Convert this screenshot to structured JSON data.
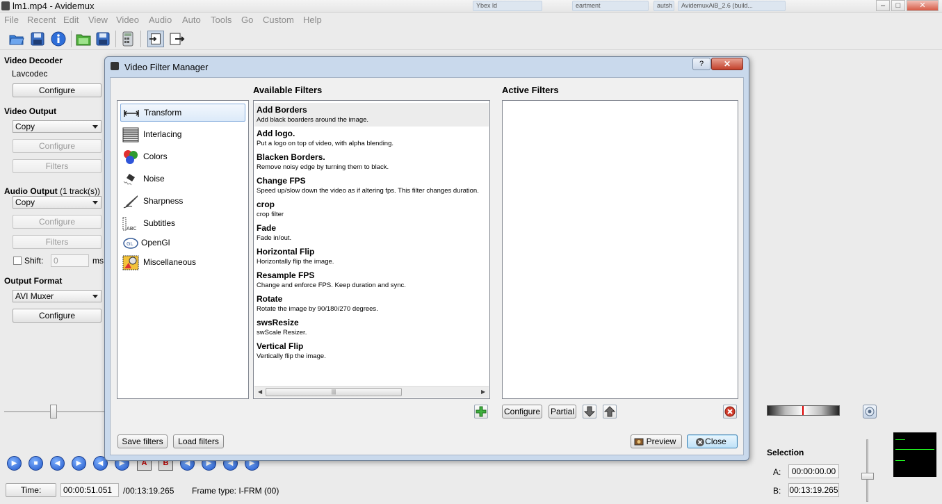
{
  "window": {
    "title": "lm1.mp4 - Avidemux",
    "bg_tabs": [
      "Ybex ld",
      "eartment",
      "autsh",
      "AvidemuxAiB_2.6 (build..."
    ],
    "controls": [
      "–",
      "□",
      "✕"
    ]
  },
  "menu": [
    "File",
    "Recent",
    "Edit",
    "View",
    "Video",
    "Audio",
    "Auto",
    "Tools",
    "Go",
    "Custom",
    "Help"
  ],
  "toolbar": {
    "icons": [
      "open-icon",
      "save-icon",
      "info-icon",
      "open-folder-icon",
      "save-video-icon",
      "calculator-icon",
      "input-icon",
      "output-icon"
    ]
  },
  "left_panel": {
    "video_decoder": {
      "title": "Video Decoder",
      "codec": "Lavcodec",
      "configure": "Configure"
    },
    "video_output": {
      "title": "Video Output",
      "value": "Copy",
      "configure": "Configure",
      "filters": "Filters"
    },
    "audio_output": {
      "title": "Audio Output",
      "tracks": "(1 track(s))",
      "value": "Copy",
      "configure": "Configure",
      "filters": "Filters",
      "shift_label": "Shift:",
      "shift_value": "0",
      "shift_unit": "ms"
    },
    "output_format": {
      "title": "Output Format",
      "value": "AVI Muxer",
      "configure": "Configure"
    }
  },
  "bottom": {
    "time_button": "Time:",
    "current_time": "00:00:51.051",
    "total_time": "/00:13:19.265",
    "frame_type": "Frame type:  I-FRM (00)",
    "selection": {
      "title": "Selection",
      "a_label": "A:",
      "a_value": "00:00:00.00",
      "b_label": "B:",
      "b_value": "00:13:19.265"
    },
    "marker_a": "A",
    "marker_b": "B"
  },
  "dialog": {
    "title": "Video Filter Manager",
    "help": "?",
    "close_x": "✕",
    "categories": [
      {
        "label": "Transform",
        "icon": "transform-icon",
        "selected": true
      },
      {
        "label": "Interlacing",
        "icon": "interlacing-icon"
      },
      {
        "label": "Colors",
        "icon": "colors-icon"
      },
      {
        "label": "Noise",
        "icon": "noise-icon"
      },
      {
        "label": "Sharpness",
        "icon": "sharpness-icon"
      },
      {
        "label": "Subtitles",
        "icon": "subtitles-icon"
      },
      {
        "label": "OpenGl",
        "icon": "opengl-icon"
      },
      {
        "label": "Miscellaneous",
        "icon": "miscellaneous-icon"
      }
    ],
    "available_title": "Available Filters",
    "active_title": "Active Filters",
    "filters": [
      {
        "name": "Add Borders",
        "desc": "Add black boarders around the image."
      },
      {
        "name": "Add logo.",
        "desc": "Put a logo on top of video, with alpha blending."
      },
      {
        "name": "Blacken Borders.",
        "desc": "Remove noisy edge by turning them to black."
      },
      {
        "name": "Change FPS",
        "desc": "Speed up/slow down the video as if altering fps. This filter changes duration."
      },
      {
        "name": "crop",
        "desc": "crop filter"
      },
      {
        "name": "Fade",
        "desc": "Fade in/out."
      },
      {
        "name": "Horizontal Flip",
        "desc": "Horizontally flip the image."
      },
      {
        "name": "Resample FPS",
        "desc": "Change and enforce FPS. Keep duration and sync."
      },
      {
        "name": "Rotate",
        "desc": "Rotate the image by 90/180/270 degrees."
      },
      {
        "name": "swsResize",
        "desc": "swScale Resizer."
      },
      {
        "name": "Vertical Flip",
        "desc": "Vertically flip the image."
      }
    ],
    "buttons": {
      "configure": "Configure",
      "partial": "Partial",
      "save_filters": "Save filters",
      "load_filters": "Load filters",
      "preview": "Preview",
      "close": "Close"
    }
  }
}
